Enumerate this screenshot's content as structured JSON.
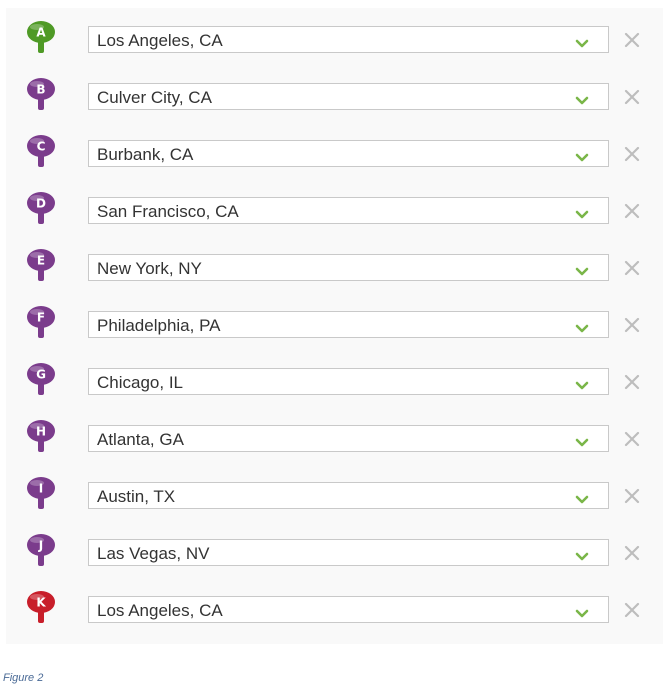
{
  "waypoints": [
    {
      "letter": "A",
      "value": "Los Angeles, CA",
      "color": "#4f9a26"
    },
    {
      "letter": "B",
      "value": "Culver City, CA",
      "color": "#7b3c8c"
    },
    {
      "letter": "C",
      "value": "Burbank, CA",
      "color": "#7b3c8c"
    },
    {
      "letter": "D",
      "value": "San Francisco, CA",
      "color": "#7b3c8c"
    },
    {
      "letter": "E",
      "value": "New York, NY",
      "color": "#7b3c8c"
    },
    {
      "letter": "F",
      "value": "Philadelphia, PA",
      "color": "#7b3c8c"
    },
    {
      "letter": "G",
      "value": "Chicago, IL",
      "color": "#7b3c8c"
    },
    {
      "letter": "H",
      "value": "Atlanta, GA",
      "color": "#7b3c8c"
    },
    {
      "letter": "I",
      "value": "Austin, TX",
      "color": "#7b3c8c"
    },
    {
      "letter": "J",
      "value": "Las Vegas, NV",
      "color": "#7b3c8c"
    },
    {
      "letter": "K",
      "value": "Los Angeles, CA",
      "color": "#c81e2a"
    }
  ],
  "icons": {
    "dropdown": "chevron-down-icon",
    "remove": "close-icon"
  },
  "accent_color": "#7ab648",
  "caption": "Figure 2"
}
